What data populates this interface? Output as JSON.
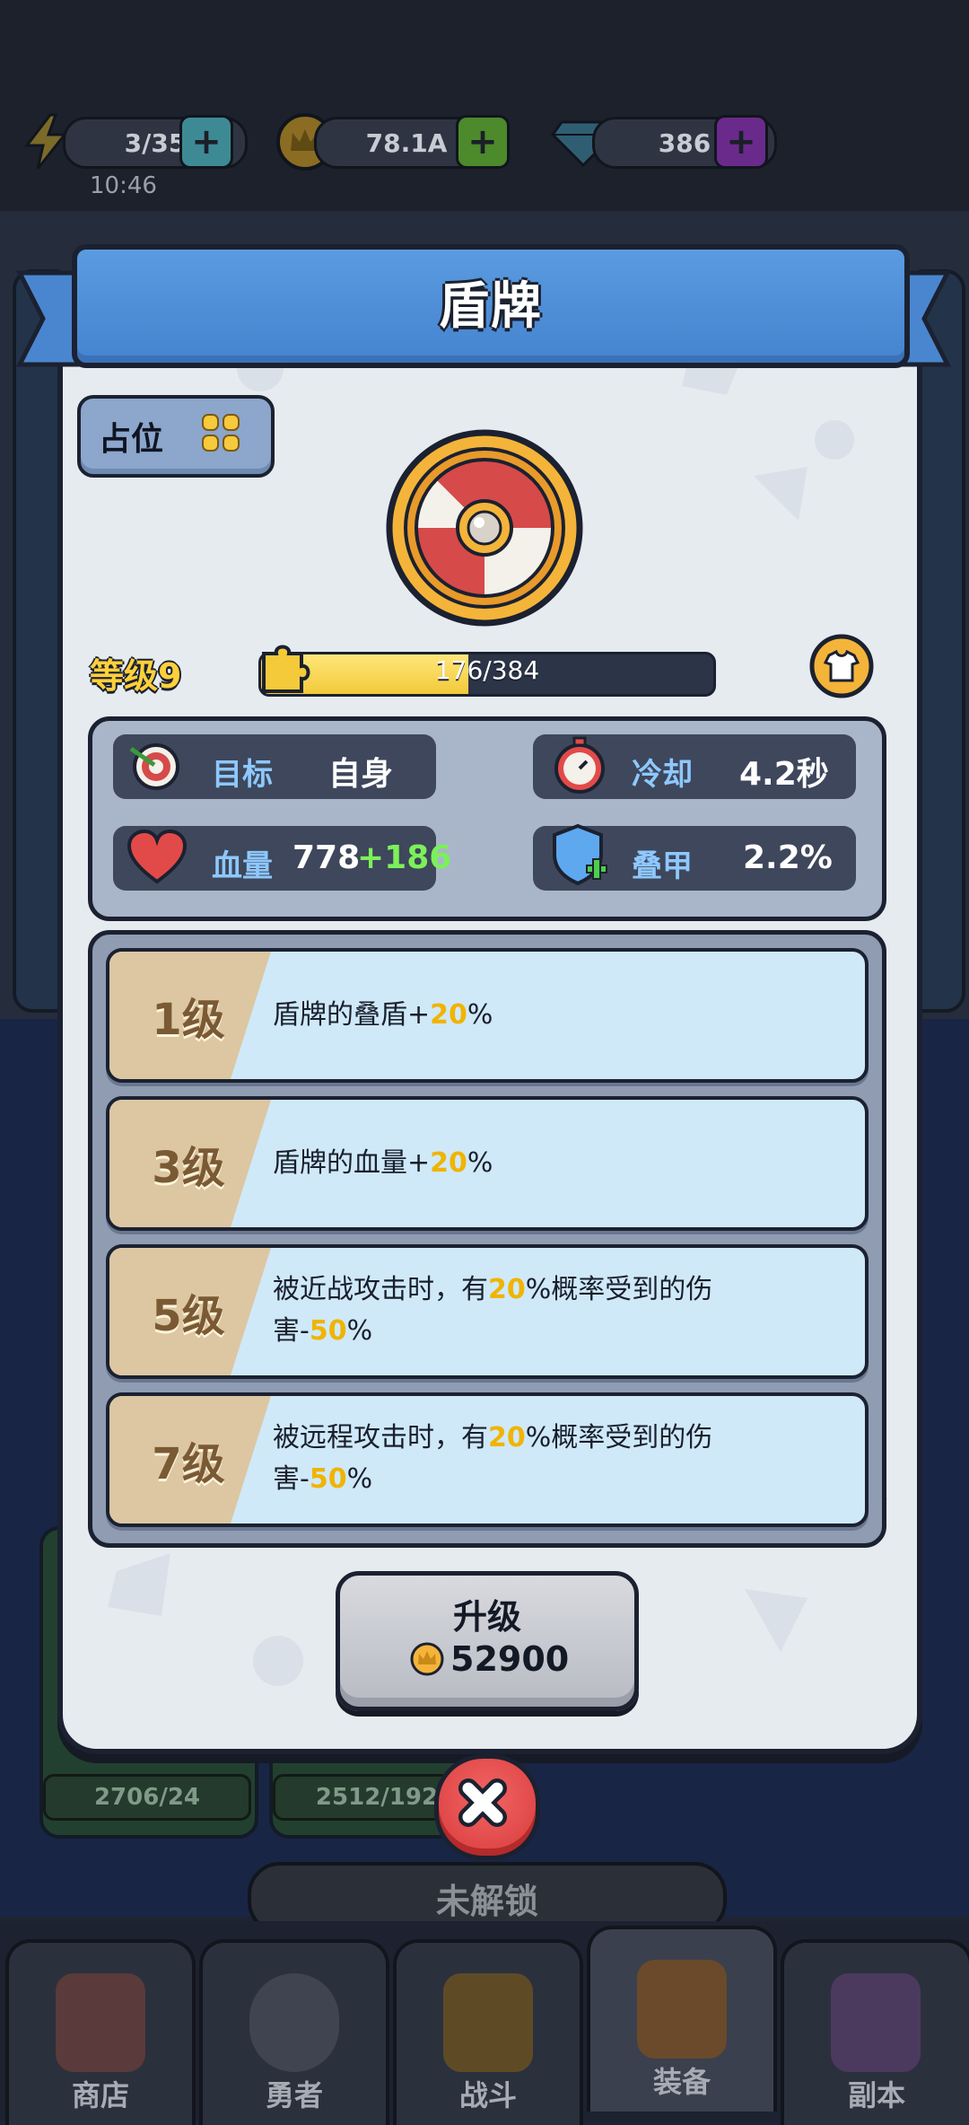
{
  "resources": {
    "energy": {
      "value": "3/35",
      "icon": "lightning-icon",
      "timer": "10:46"
    },
    "gold": {
      "value": "78.1A",
      "icon": "crown-coin-icon"
    },
    "gems": {
      "value": "386",
      "icon": "diamond-icon"
    }
  },
  "modal": {
    "title": "盾牌",
    "slot_label": "占位",
    "level_label": "等级9",
    "exp_text": "176/384",
    "exp_fraction": 0.458,
    "stats": {
      "target": {
        "name": "目标",
        "value": "自身"
      },
      "cooldown": {
        "name": "冷却",
        "value": "4.2秒"
      },
      "hp": {
        "name": "血量",
        "value": "778",
        "bonus": "+186"
      },
      "armor": {
        "name": "叠甲",
        "value": "2.2%"
      }
    },
    "perks": [
      {
        "level": "1级",
        "pre": "盾牌的叠盾+",
        "num": "20",
        "post": "%"
      },
      {
        "level": "3级",
        "pre": "盾牌的血量+",
        "num": "20",
        "post": "%"
      },
      {
        "level": "5级",
        "pre": "被近战攻击时，有",
        "num": "20",
        "mid": "%概率受到的伤害-",
        "num2": "50",
        "post": "%"
      },
      {
        "level": "7级",
        "pre": "被远程攻击时，有",
        "num": "20",
        "mid": "%概率受到的伤害-",
        "num2": "50",
        "post": "%"
      }
    ],
    "upgrade_label": "升级",
    "upgrade_cost": "52900"
  },
  "background": {
    "card_counts": [
      "2706/24",
      "2512/192"
    ],
    "locked_label": "未解锁"
  },
  "nav": [
    {
      "label": "商店",
      "icon": "shop-icon"
    },
    {
      "label": "勇者",
      "icon": "hero-icon"
    },
    {
      "label": "战斗",
      "icon": "battle-icon"
    },
    {
      "label": "装备",
      "icon": "equipment-icon"
    },
    {
      "label": "副本",
      "icon": "dungeon-icon"
    }
  ],
  "colors": {
    "title_bar": "#4a8bd6",
    "accent_yellow": "#f0b400",
    "bonus_green": "#7cf05a",
    "close_red": "#e04848"
  }
}
